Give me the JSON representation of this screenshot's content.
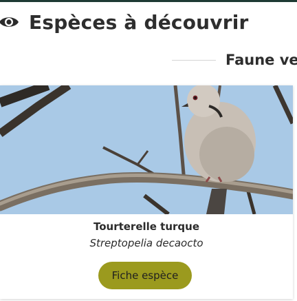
{
  "header": {
    "title": "Espèces à découvrir",
    "icon": "eye-icon"
  },
  "subheading": {
    "label": "Faune ve"
  },
  "card": {
    "common_name": "Tourterelle turque",
    "latin_name": "Streptopelia decaocto",
    "button_label": "Fiche espèce",
    "photo_alt": "Tourterelle turque"
  },
  "colors": {
    "accent_button": "#9b9a1e",
    "top_border": "#1e3a34",
    "sky": "#a9c9e6",
    "text": "#2e2e2e"
  }
}
